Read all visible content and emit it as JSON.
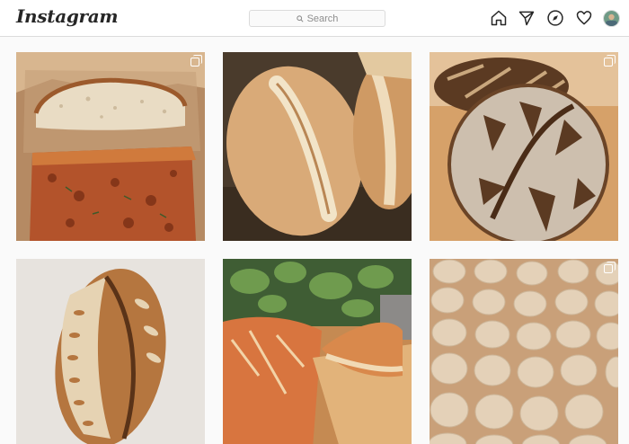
{
  "header": {
    "logo_text": "Instagram",
    "search_placeholder": "Search"
  },
  "nav_icons": [
    "home-icon",
    "direct-message-icon",
    "explore-icon",
    "activity-heart-icon",
    "profile-avatar"
  ],
  "posts": [
    {
      "subject": "focaccia-and-sliced-loaf",
      "multi_image": true
    },
    {
      "subject": "scored-bread-loaves",
      "multi_image": false
    },
    {
      "subject": "floured-sourdough-boule",
      "multi_image": true
    },
    {
      "subject": "wheat-pattern-sourdough",
      "multi_image": false
    },
    {
      "subject": "loaves-with-plants",
      "multi_image": false
    },
    {
      "subject": "raw-dough-rounds",
      "multi_image": true
    }
  ],
  "colors": {
    "background": "#fafafa",
    "border": "#dbdbdb",
    "icon": "#262626",
    "muted_text": "#8e8e8e"
  }
}
